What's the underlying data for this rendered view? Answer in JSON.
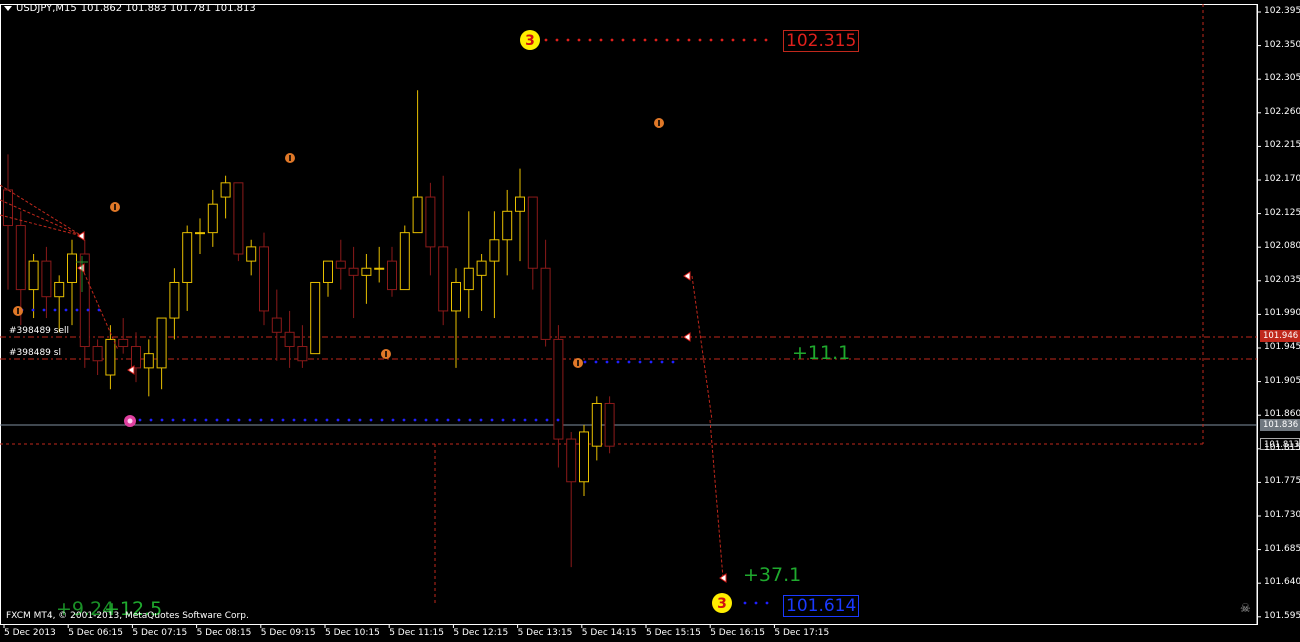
{
  "header": {
    "symbol": "USDJPY,M15",
    "ohlc": "101.862 101.883 101.781 101.813"
  },
  "copyright": "FXCM MT4, © 2001-2013, MetaQuotes Software Corp.",
  "price_axis": {
    "ticks": [
      "102.395",
      "102.350",
      "102.305",
      "102.260",
      "102.215",
      "102.170",
      "102.125",
      "102.080",
      "102.035",
      "101.990",
      "101.945",
      "101.905",
      "101.860",
      "101.815",
      "101.775",
      "101.730",
      "101.685",
      "101.640",
      "101.595"
    ],
    "range": [
      101.57,
      102.42
    ]
  },
  "time_axis": {
    "ticks": [
      "5 Dec 2013",
      "5 Dec 06:15",
      "5 Dec 07:15",
      "5 Dec 08:15",
      "5 Dec 09:15",
      "5 Dec 10:15",
      "5 Dec 11:15",
      "5 Dec 12:15",
      "5 Dec 13:15",
      "5 Dec 14:15",
      "5 Dec 15:15",
      "5 Dec 16:15",
      "5 Dec 17:15"
    ]
  },
  "order_labels": {
    "sell": "#398489 sell",
    "sl": "#398489 sl"
  },
  "levels": {
    "high_label": "102.315",
    "low_label": "101.614",
    "sell_price": "101.946",
    "bid_price": "101.836",
    "last_price": "101.813",
    "high_marker": "3",
    "low_marker": "3"
  },
  "profit_labels": {
    "upper": "+11.1",
    "lower": "+37.1",
    "left_a": "+9.24",
    "left_b": "+12.5"
  },
  "colors": {
    "bull": "#e8c000",
    "bear": "#8b1a1a",
    "green_text": "#1faa2e",
    "red_level": "#c0281c",
    "blue_dots": "#2020ff",
    "orange_marker": "#e07828"
  },
  "chart_data": {
    "type": "candlestick",
    "title": "USDJPY,M15",
    "xlabel": "",
    "ylabel": "",
    "ylim": [
      101.57,
      102.42
    ],
    "candles": [
      {
        "o": 102.17,
        "h": 102.22,
        "l": 102.03,
        "c": 102.12
      },
      {
        "o": 102.12,
        "h": 102.14,
        "l": 101.98,
        "c": 102.03
      },
      {
        "o": 102.03,
        "h": 102.08,
        "l": 101.99,
        "c": 102.07
      },
      {
        "o": 102.07,
        "h": 102.09,
        "l": 101.99,
        "c": 102.02
      },
      {
        "o": 102.02,
        "h": 102.05,
        "l": 101.97,
        "c": 102.04
      },
      {
        "o": 102.04,
        "h": 102.1,
        "l": 101.98,
        "c": 102.08
      },
      {
        "o": 102.08,
        "h": 102.1,
        "l": 101.92,
        "c": 101.95
      },
      {
        "o": 101.95,
        "h": 101.96,
        "l": 101.91,
        "c": 101.93
      },
      {
        "o": 101.91,
        "h": 101.98,
        "l": 101.89,
        "c": 101.96
      },
      {
        "o": 101.96,
        "h": 101.99,
        "l": 101.94,
        "c": 101.95
      },
      {
        "o": 101.95,
        "h": 101.97,
        "l": 101.9,
        "c": 101.92
      },
      {
        "o": 101.92,
        "h": 101.96,
        "l": 101.88,
        "c": 101.94
      },
      {
        "o": 101.92,
        "h": 101.99,
        "l": 101.89,
        "c": 101.99
      },
      {
        "o": 101.99,
        "h": 102.06,
        "l": 101.96,
        "c": 102.04
      },
      {
        "o": 102.04,
        "h": 102.12,
        "l": 102.0,
        "c": 102.11
      },
      {
        "o": 102.11,
        "h": 102.13,
        "l": 102.08,
        "c": 102.11
      },
      {
        "o": 102.11,
        "h": 102.17,
        "l": 102.09,
        "c": 102.15
      },
      {
        "o": 102.16,
        "h": 102.19,
        "l": 102.13,
        "c": 102.18
      },
      {
        "o": 102.18,
        "h": 102.18,
        "l": 102.07,
        "c": 102.08
      },
      {
        "o": 102.07,
        "h": 102.1,
        "l": 102.05,
        "c": 102.09
      },
      {
        "o": 102.09,
        "h": 102.11,
        "l": 101.98,
        "c": 102.0
      },
      {
        "o": 101.99,
        "h": 102.03,
        "l": 101.93,
        "c": 101.97
      },
      {
        "o": 101.97,
        "h": 102.0,
        "l": 101.92,
        "c": 101.95
      },
      {
        "o": 101.95,
        "h": 101.98,
        "l": 101.92,
        "c": 101.93
      },
      {
        "o": 101.94,
        "h": 102.04,
        "l": 101.94,
        "c": 102.04
      },
      {
        "o": 102.04,
        "h": 102.07,
        "l": 102.02,
        "c": 102.07
      },
      {
        "o": 102.07,
        "h": 102.1,
        "l": 102.03,
        "c": 102.06
      },
      {
        "o": 102.06,
        "h": 102.09,
        "l": 101.99,
        "c": 102.05
      },
      {
        "o": 102.05,
        "h": 102.08,
        "l": 102.01,
        "c": 102.06
      },
      {
        "o": 102.06,
        "h": 102.09,
        "l": 102.04,
        "c": 102.06
      },
      {
        "o": 102.07,
        "h": 102.09,
        "l": 102.02,
        "c": 102.03
      },
      {
        "o": 102.03,
        "h": 102.12,
        "l": 102.03,
        "c": 102.11
      },
      {
        "o": 102.11,
        "h": 102.31,
        "l": 102.11,
        "c": 102.16
      },
      {
        "o": 102.16,
        "h": 102.18,
        "l": 102.05,
        "c": 102.09
      },
      {
        "o": 102.09,
        "h": 102.19,
        "l": 101.98,
        "c": 102.0
      },
      {
        "o": 102.0,
        "h": 102.06,
        "l": 101.92,
        "c": 102.04
      },
      {
        "o": 102.03,
        "h": 102.14,
        "l": 101.99,
        "c": 102.06
      },
      {
        "o": 102.05,
        "h": 102.08,
        "l": 102.0,
        "c": 102.07
      },
      {
        "o": 102.07,
        "h": 102.14,
        "l": 101.99,
        "c": 102.1
      },
      {
        "o": 102.1,
        "h": 102.17,
        "l": 102.05,
        "c": 102.14
      },
      {
        "o": 102.14,
        "h": 102.2,
        "l": 102.07,
        "c": 102.16
      },
      {
        "o": 102.16,
        "h": 102.16,
        "l": 102.03,
        "c": 102.06
      },
      {
        "o": 102.06,
        "h": 102.1,
        "l": 101.95,
        "c": 101.96
      },
      {
        "o": 101.96,
        "h": 101.98,
        "l": 101.78,
        "c": 101.82
      },
      {
        "o": 101.82,
        "h": 101.83,
        "l": 101.64,
        "c": 101.76
      },
      {
        "o": 101.76,
        "h": 101.84,
        "l": 101.74,
        "c": 101.83
      },
      {
        "o": 101.81,
        "h": 101.88,
        "l": 101.79,
        "c": 101.87
      },
      {
        "o": 101.87,
        "h": 101.88,
        "l": 101.8,
        "c": 101.81
      }
    ]
  }
}
